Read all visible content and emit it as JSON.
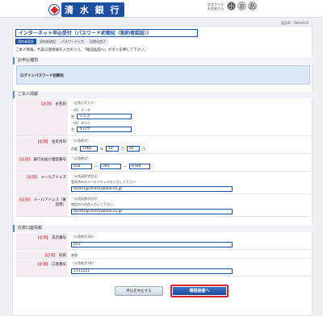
{
  "header": {
    "bank_name": "清 水 銀 行",
    "fontsize_label": "文字サイズを変更する",
    "fontsize_buttons": [
      "小",
      "あ",
      "あ"
    ],
    "screen_id": "画面ID：INMA515"
  },
  "page": {
    "title": "インターネット申込受付（パスワード初期化〈契約者認証〉）",
    "steps": [
      "契約者認証",
      "契約者確認",
      "パスワード入力",
      "初期化完了"
    ],
    "instruction": "ご本人情報、代表口座情報を入力のうえ、「確認画面へ」ボタンを押して下さい。"
  },
  "application": {
    "heading": "お申込種別",
    "type": "ログインパスワード初期化"
  },
  "personal": {
    "heading": "ご本人情報",
    "required": "【必須】",
    "name": {
      "label": "お名前",
      "hint": "（全角カタカナ）",
      "mei_ex": "（例）データ",
      "sei_label": "姓",
      "sei_value": "シミズ",
      "mei_ex2": "（例）タロウ",
      "mei_label": "名",
      "mei_value": "タロウ"
    },
    "birth": {
      "label": "生年月日",
      "hint": "（半角数字）",
      "era": "西暦",
      "year": "1965",
      "year_unit": "年",
      "month": "10",
      "month_unit": "月",
      "day": "05",
      "day_unit": "日"
    },
    "phone": {
      "label": "銀行お届け電話番号",
      "hint": "（半角数字）",
      "p1": "012",
      "p2": "345",
      "p3": "6789",
      "dash": "―"
    },
    "email": {
      "label": "メールアドレス",
      "hint": "（半角英数字記号）",
      "note": "登録済みのメールアドレスを入力して下さい",
      "value": "taro01@shimizubank.co.jp"
    },
    "email_confirm": {
      "label": "メールアドレス（確認用）",
      "hint": "（半角英数字記号）",
      "note": "確認のため再入力して下さい",
      "value": "taro01@shimizubank.co.jp"
    }
  },
  "account": {
    "heading": "代表口座情報",
    "branch": {
      "label": "支店番号",
      "hint": "（半角数字3桁）",
      "value": "251"
    },
    "type": {
      "label": "科目",
      "value": "普通"
    },
    "number": {
      "label": "口座番号",
      "hint": "（半角数字7桁）",
      "value": "1111111"
    }
  },
  "buttons": {
    "cancel": "申込を中止する",
    "confirm": "確認画面へ"
  },
  "colors": {
    "brand": "#1c4fa0",
    "required": "#d8232a"
  }
}
